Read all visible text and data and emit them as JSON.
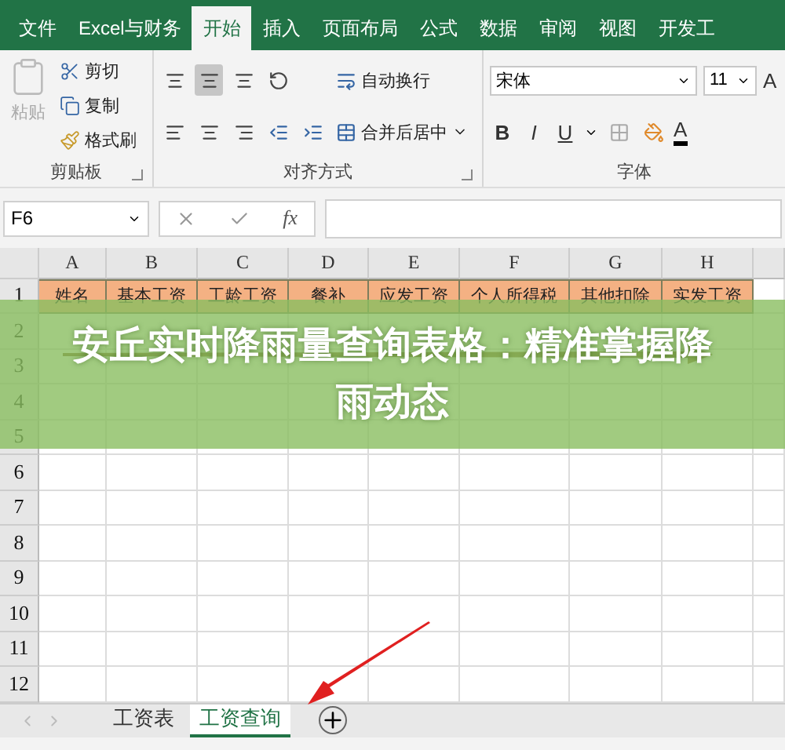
{
  "ribbon_tabs": [
    {
      "label": "文件",
      "selected": false
    },
    {
      "label": "Excel与财务",
      "selected": false
    },
    {
      "label": "开始",
      "selected": true
    },
    {
      "label": "插入",
      "selected": false
    },
    {
      "label": "页面布局",
      "selected": false
    },
    {
      "label": "公式",
      "selected": false
    },
    {
      "label": "数据",
      "selected": false
    },
    {
      "label": "审阅",
      "selected": false
    },
    {
      "label": "视图",
      "selected": false
    },
    {
      "label": "开发工",
      "selected": false
    }
  ],
  "clipboard": {
    "paste": {
      "label": "粘贴",
      "disabled": true
    },
    "commands": [
      "剪切",
      "复制",
      "格式刷"
    ],
    "group_label": "剪贴板"
  },
  "alignment": {
    "wrap_text": "自动换行",
    "merge_center": "合并后居中",
    "group_label": "对齐方式"
  },
  "font": {
    "font_name": "宋体",
    "font_size": "11",
    "grow_font": "A",
    "styles": [
      "B",
      "I",
      "U"
    ],
    "font_color": "A",
    "group_label": "字体"
  },
  "formula_bar": {
    "name_box": "F6",
    "fx": "fx"
  },
  "sheet": {
    "columns": [
      "A",
      "B",
      "C",
      "D",
      "E",
      "F",
      "G",
      "H"
    ],
    "rows": [
      "1",
      "2",
      "3",
      "4",
      "5",
      "6",
      "7",
      "8",
      "9",
      "10",
      "11",
      "12"
    ],
    "headers": [
      "姓名",
      "基本工资",
      "工龄工资",
      "餐补",
      "应发工资",
      "个人所得税",
      "其他扣除",
      "实发工资"
    ]
  },
  "banner": {
    "title": "安丘实时降雨量查询表格：精准掌握降雨动态"
  },
  "sheet_tabs": [
    {
      "label": "工资表",
      "selected": false
    },
    {
      "label": "工资查询",
      "selected": true
    }
  ]
}
